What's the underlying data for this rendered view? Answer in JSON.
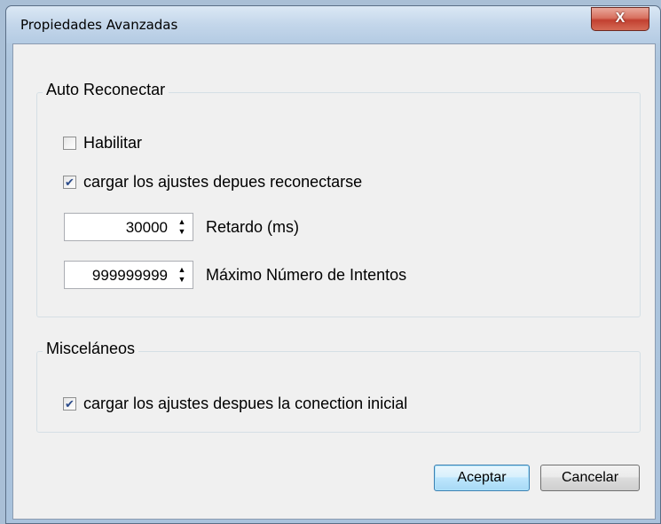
{
  "window": {
    "title": "Propiedades Avanzadas",
    "close_glyph": "X"
  },
  "auto_reconnect": {
    "label": "Auto Reconectar",
    "enable": {
      "label": "Habilitar",
      "checked": false
    },
    "reload_settings": {
      "label": "cargar los ajustes depues reconectarse",
      "checked": true
    },
    "delay": {
      "value": "30000",
      "label": "Retardo (ms)"
    },
    "max_attempts": {
      "value": "999999999",
      "label": "Máximo Número de Intentos"
    }
  },
  "misc": {
    "label": "Misceláneos",
    "reload_initial": {
      "label": "cargar los ajustes despues la conection inicial",
      "checked": true
    }
  },
  "buttons": {
    "accept": "Aceptar",
    "cancel": "Cancelar"
  },
  "icons": {
    "check": "✔",
    "up": "▲",
    "down": "▼"
  }
}
